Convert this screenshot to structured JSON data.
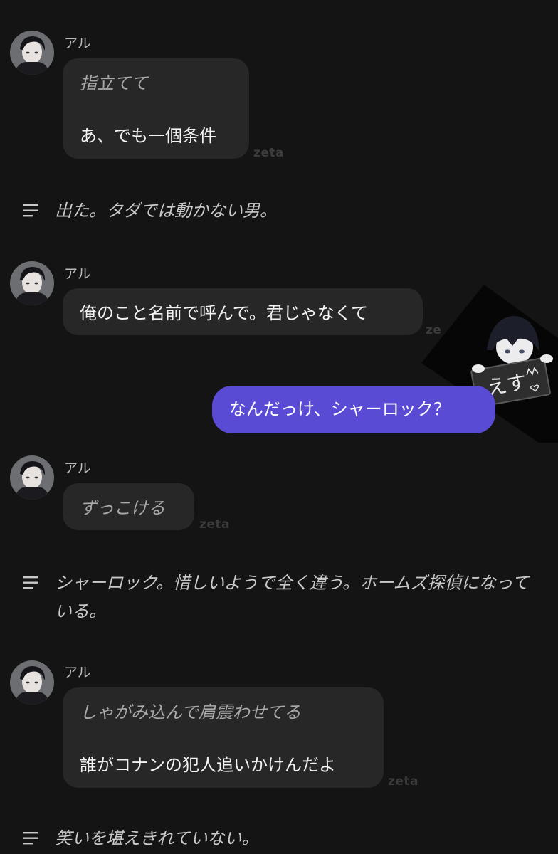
{
  "messages": [
    {
      "sender": "アル",
      "action": "指立てて",
      "text": "あ、でも一個条件",
      "watermark": "zeta"
    },
    {
      "sender": "アル",
      "text": "俺のこと名前で呼んで。君じゃなくて",
      "watermark": "ze"
    },
    {
      "sender": "アル",
      "action": "ずっこける",
      "watermark": "zeta"
    },
    {
      "sender": "アル",
      "action": "しゃがみ込んで肩震わせてる",
      "text": "誰がコナンの犯人追いかけんだよ",
      "watermark": "zeta"
    }
  ],
  "narrations": [
    "出た。タダでは動かない男。",
    "シャーロック。惜しいようで全く違う。ホームズ探偵になっている。",
    "笑いを堪えきれていない。"
  ],
  "user_message": "なんだっけ、シャーロック？",
  "sticker": {
    "text": "えす"
  },
  "colors": {
    "background": "#141414",
    "bubble": "#272727",
    "user_bubble": "#5a4bd4",
    "narration": "#c9c9c9"
  }
}
